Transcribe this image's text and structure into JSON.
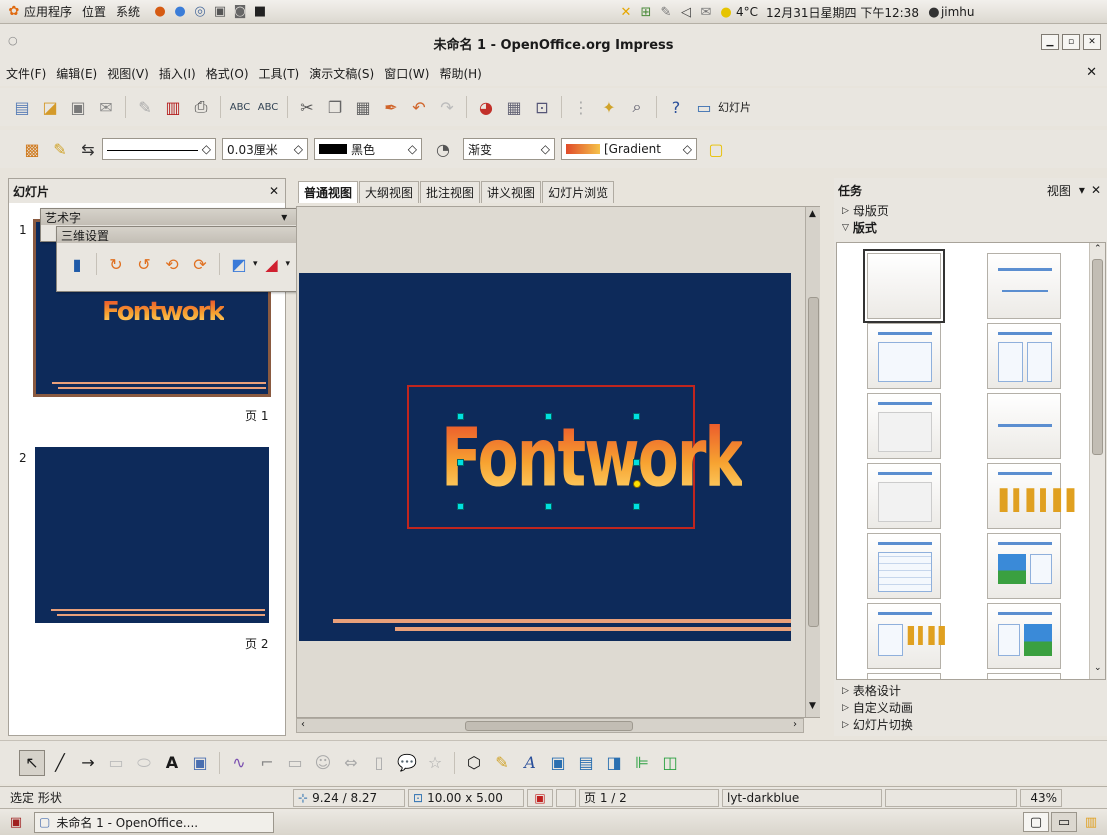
{
  "top_panel": {
    "menus": [
      "应用程序",
      "位置",
      "系统"
    ],
    "weather": "4°C",
    "datetime": "12月31日星期四 下午12:38",
    "user": "jimhu"
  },
  "window": {
    "title": "未命名 1 - OpenOffice.org Impress"
  },
  "menubar": {
    "items": [
      "文件(F)",
      "编辑(E)",
      "视图(V)",
      "插入(I)",
      "格式(O)",
      "工具(T)",
      "演示文稿(S)",
      "窗口(W)",
      "帮助(H)"
    ]
  },
  "standard_toolbar": {
    "slide_button_label": "幻灯片"
  },
  "line_fill_toolbar": {
    "line_width": "0.03厘米",
    "line_color": "黑色",
    "area_style": "渐变",
    "area_fill": "[Gradient"
  },
  "slides_pane": {
    "title": "幻灯片",
    "slides": [
      {
        "number": "1",
        "label": "页 1",
        "fontwork": "Fontwork"
      },
      {
        "number": "2",
        "label": "页 2"
      }
    ]
  },
  "floating_toolbars": {
    "fontwork_title": "艺术字",
    "threed_title": "三维设置"
  },
  "editor": {
    "tabs": [
      "普通视图",
      "大纲视图",
      "批注视图",
      "讲义视图",
      "幻灯片浏览"
    ],
    "slide_text": "Fontwork"
  },
  "task_pane": {
    "title": "任务",
    "view_label": "视图",
    "sections_top": [
      "母版页",
      "版式"
    ],
    "sections_bottom": [
      "表格设计",
      "自定义动画",
      "幻灯片切换"
    ]
  },
  "statusbar": {
    "status": "选定 形状",
    "position": "9.24 / 8.27",
    "size": "10.00 x 5.00",
    "page": "页 1 / 2",
    "master": "lyt-darkblue",
    "zoom": "43%"
  },
  "taskbar": {
    "window_button": "未命名 1 - OpenOffice...."
  },
  "colors": {
    "slide_bg": "#0d2a5a",
    "accent_line": "#e9a07a",
    "selection_handle": "#00e0e0"
  }
}
